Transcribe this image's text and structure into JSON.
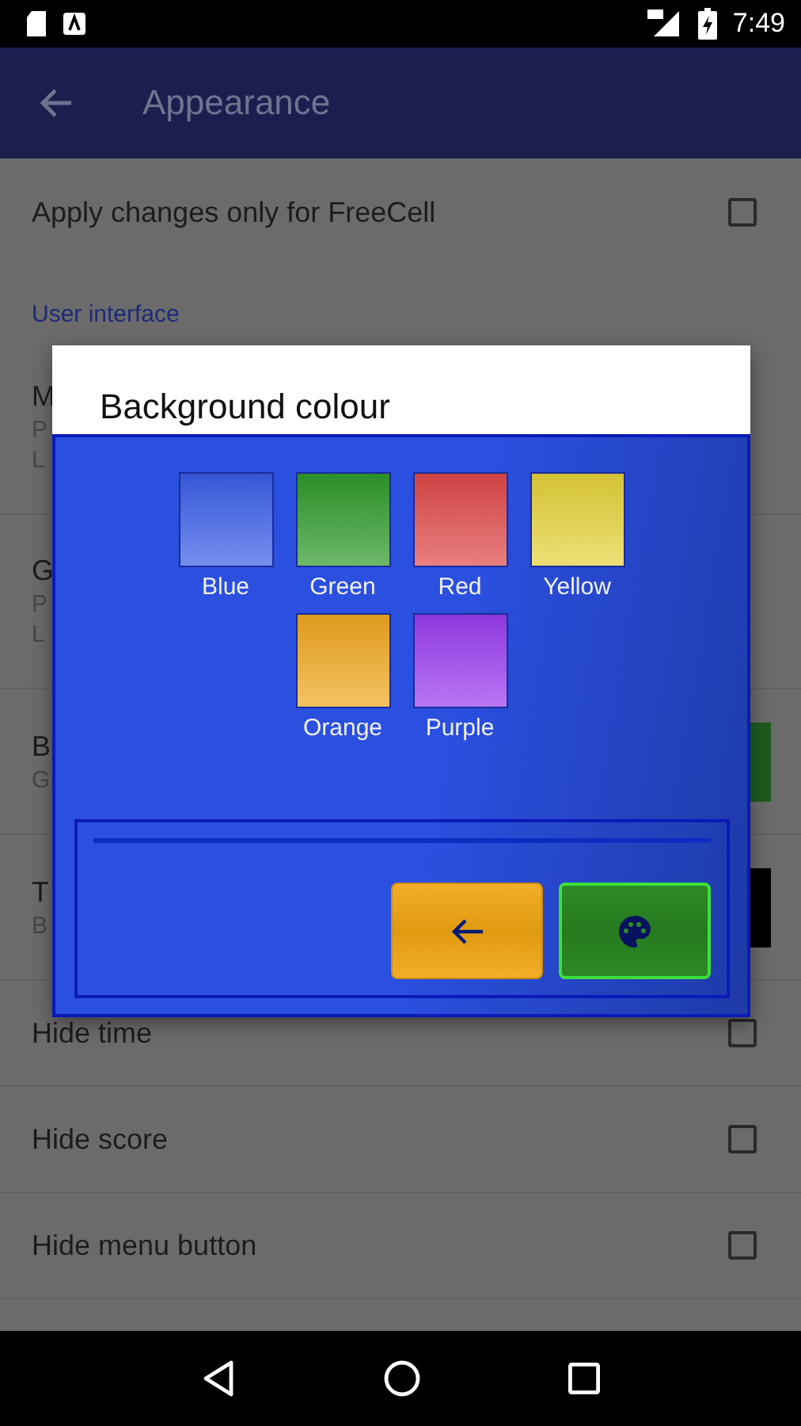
{
  "status_bar": {
    "time": "7:49"
  },
  "toolbar": {
    "title": "Appearance"
  },
  "settings": [
    {
      "kind": "checkbox",
      "title": "Apply changes only for FreeCell",
      "checked": false
    },
    {
      "kind": "header",
      "title": "User interface"
    },
    {
      "kind": "text",
      "title": "M",
      "lines": [
        "P",
        "L"
      ]
    },
    {
      "kind": "text",
      "title": "G",
      "lines": [
        "P",
        "L"
      ]
    },
    {
      "kind": "swatch",
      "title": "B",
      "lines": [
        "G"
      ],
      "color": "#1f5c1f"
    },
    {
      "kind": "swatch",
      "title": "T",
      "lines": [
        "B"
      ],
      "color": "#000000"
    },
    {
      "kind": "checkbox",
      "title": "Hide time",
      "checked": false
    },
    {
      "kind": "checkbox",
      "title": "Hide score",
      "checked": false
    },
    {
      "kind": "checkbox",
      "title": "Hide menu button",
      "checked": false
    }
  ],
  "dialog": {
    "title": "Background colour",
    "colours": [
      {
        "label": "Blue",
        "color": "#3a5ee8"
      },
      {
        "label": "Green",
        "color": "#2e9a2a"
      },
      {
        "label": "Red",
        "color": "#e04848"
      },
      {
        "label": "Yellow",
        "color": "#e6d23a"
      },
      {
        "label": "Orange",
        "color": "#f0a820"
      },
      {
        "label": "Purple",
        "color": "#9a3cf0"
      }
    ]
  }
}
